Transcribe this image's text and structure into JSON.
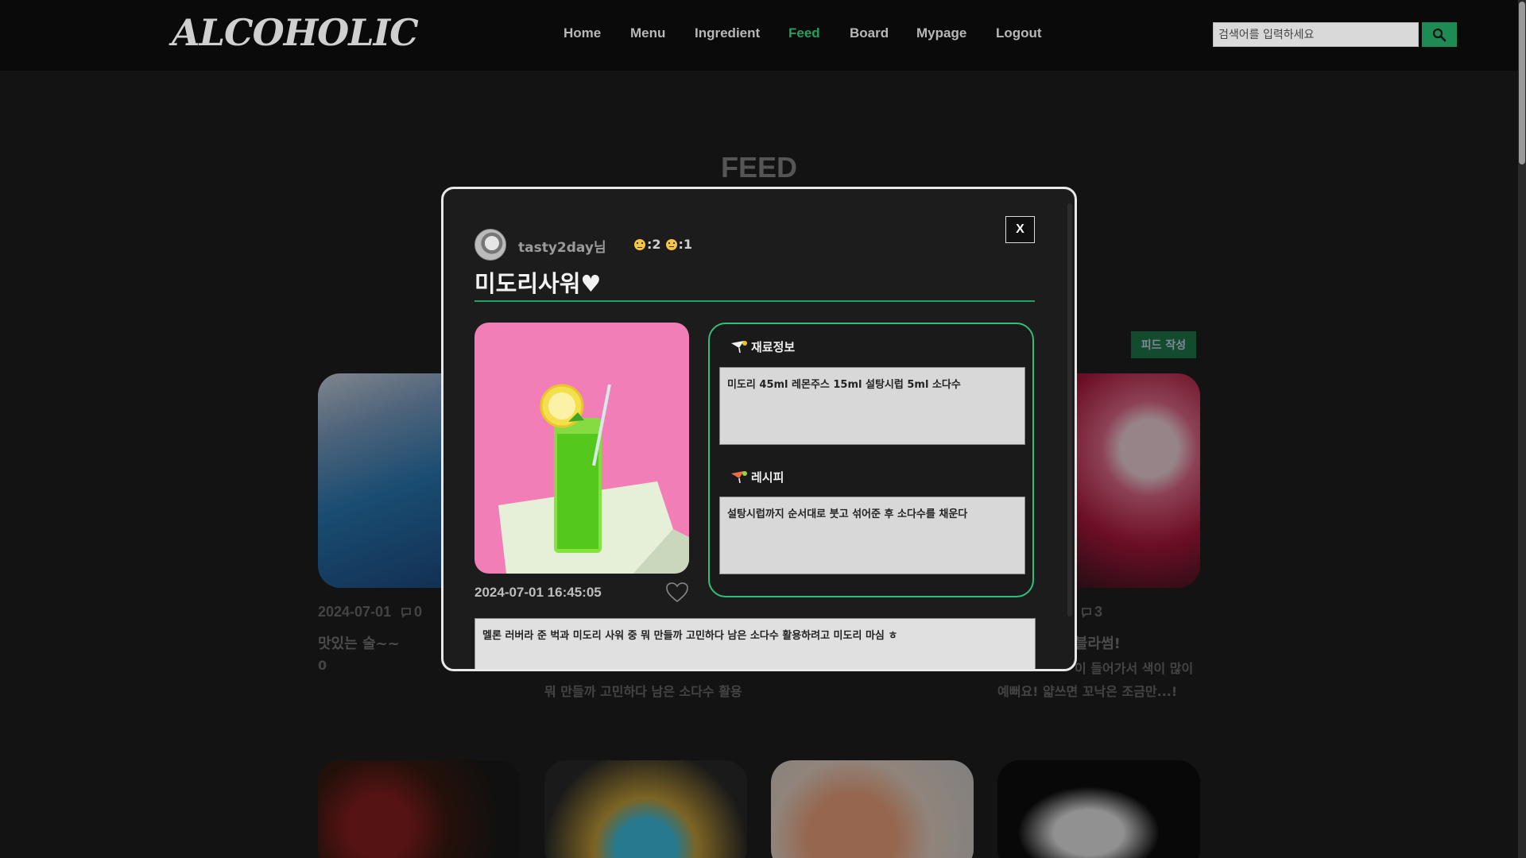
{
  "header": {
    "logo": "ALCOHOLIC",
    "nav": [
      {
        "label": "Home",
        "active": false
      },
      {
        "label": "Menu",
        "active": false
      },
      {
        "label": "Ingredient",
        "active": false
      },
      {
        "label": "Feed",
        "active": true
      },
      {
        "label": "Board",
        "active": false
      },
      {
        "label": "Mypage",
        "active": false
      },
      {
        "label": "Logout",
        "active": false
      }
    ],
    "search_placeholder": "검색어를 입력하세요"
  },
  "page": {
    "title": "FEED",
    "write_button": "피드 작성",
    "cards": [
      {
        "date": "2024-07-01",
        "comments": "0",
        "title": "맛있는 술~~",
        "sub": "0"
      },
      {
        "sub": "뭐 만들까 고민하다 남은 소다수 활용"
      },
      {
        "comments": "3",
        "title": "블라썸!",
        "sub": "이 들어가서 색이 많이",
        "sub2": "예뻐요! 얇쓰면 꼬낙은 조금만...!"
      }
    ]
  },
  "modal": {
    "author": "tasty2day님",
    "likes_count": ":2",
    "dislikes_count": ":1",
    "close_label": "X",
    "title": "미도리사워♥",
    "date": "2024-07-01 16:45:05",
    "ingredients_label": "재료정보",
    "ingredients": "미도리 45ml 레몬주스 15ml 설탕시럽 5ml 소다수",
    "recipe_label": "레시피",
    "recipe": "설탕시럽까지 순서대로 붓고 섞어준 후 소다수를 채운다",
    "content": "멜론 러버라 준 벅과 미도리 사워 중 뭐 만들까 고민하다 남은 소다수 활용하려고 미도리 마심 ㅎ"
  },
  "colors": {
    "accent": "#21a06a",
    "header_bg": "#0a0a0a",
    "modal_bg": "#1c1c1c"
  }
}
